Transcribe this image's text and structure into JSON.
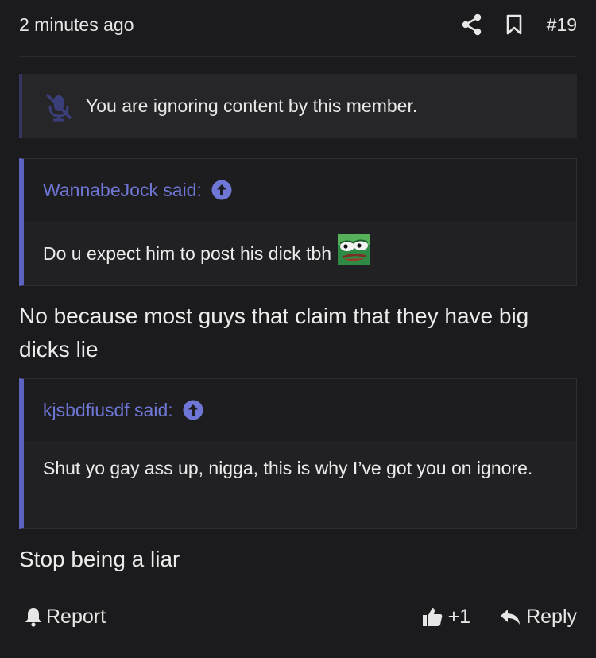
{
  "header": {
    "timestamp": "2 minutes ago",
    "post_number": "#19",
    "share_icon": "share-icon",
    "bookmark_icon": "bookmark-icon"
  },
  "ignore_notice": {
    "icon": "mute-icon",
    "text": "You are ignoring content by this member."
  },
  "quotes": [
    {
      "author_line": "WannabeJock said:",
      "text": "Do u expect him to post his dick tbh",
      "emoji": "pepe-icon"
    },
    {
      "author_line": "kjsbdfiusdf said:",
      "text": "Shut yo gay ass up, nigga, this is why I’ve got you on ignore."
    }
  ],
  "messages": [
    "No because most guys that claim that they have big dicks lie",
    "Stop being a liar"
  ],
  "footer": {
    "report_label": "Report",
    "like_count": "+1",
    "reply_label": "Reply"
  },
  "colors": {
    "background": "#1b1b1d",
    "accent": "#5b62c0",
    "link": "#6f77d6"
  }
}
